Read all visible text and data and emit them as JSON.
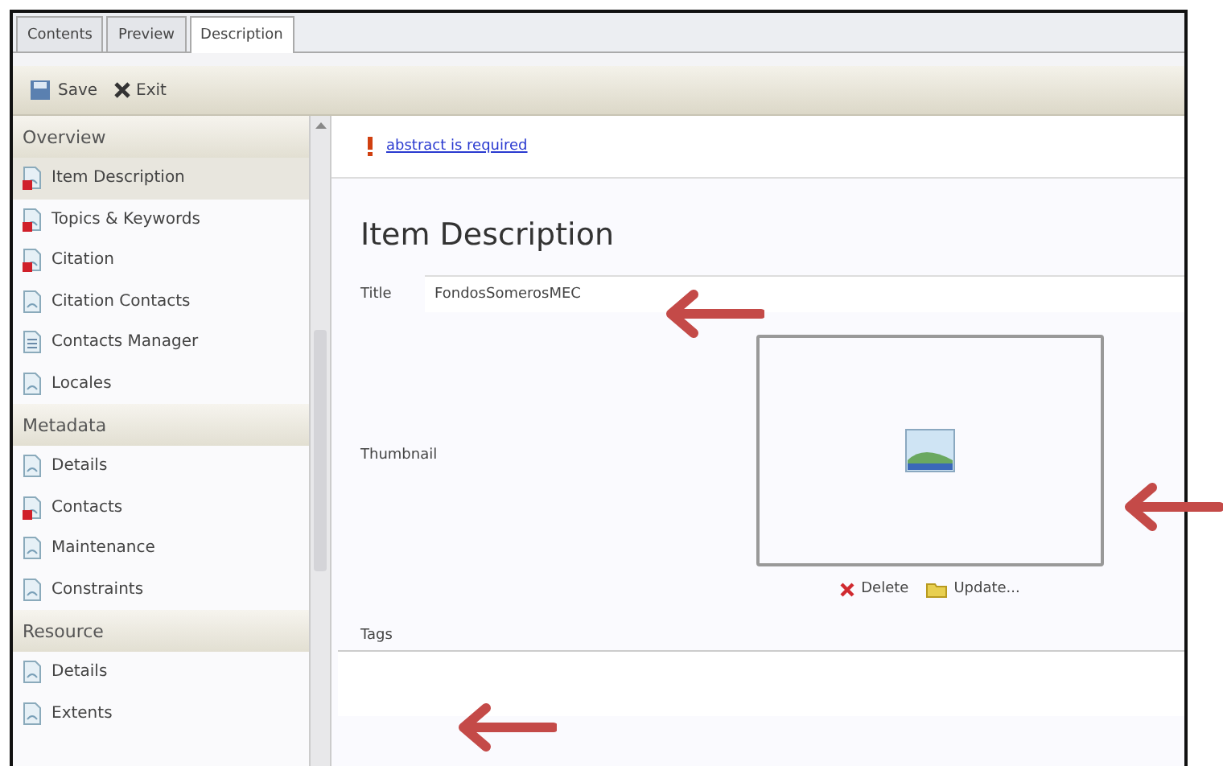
{
  "tabs": [
    {
      "label": "Contents",
      "selected": false
    },
    {
      "label": "Preview",
      "selected": false
    },
    {
      "label": "Description",
      "selected": true
    }
  ],
  "toolbar": [
    {
      "label": "Save",
      "kind": "save"
    },
    {
      "label": "Exit",
      "kind": "exit"
    }
  ],
  "sidebar": [
    {
      "title": "Overview",
      "items": [
        {
          "label": "Item Description",
          "error": true,
          "selected": true
        },
        {
          "label": "Topics & Keywords",
          "error": true,
          "selected": false
        },
        {
          "label": "Citation",
          "error": true,
          "selected": false
        },
        {
          "label": "Citation Contacts",
          "error": false,
          "selected": false
        },
        {
          "label": "Contacts Manager",
          "error": false,
          "selected": false,
          "kind": "list"
        },
        {
          "label": "Locales",
          "error": false,
          "selected": false
        }
      ]
    },
    {
      "title": "Metadata",
      "items": [
        {
          "label": "Details",
          "error": false,
          "selected": false
        },
        {
          "label": "Contacts",
          "error": true,
          "selected": false
        },
        {
          "label": "Maintenance",
          "error": false,
          "selected": false
        },
        {
          "label": "Constraints",
          "error": false,
          "selected": false
        }
      ]
    },
    {
      "title": "Resource",
      "items": [
        {
          "label": "Details",
          "error": false,
          "selected": false
        },
        {
          "label": "Extents",
          "error": false,
          "selected": false
        }
      ]
    }
  ],
  "message": {
    "link": "abstract is required"
  },
  "heading": "Item Description",
  "title_field": {
    "label": "Title",
    "value": "FondosSomerosMEC"
  },
  "thumbnail": {
    "label": "Thumbnail",
    "actions": [
      {
        "label": "Delete",
        "kind": "delete"
      },
      {
        "label": "Update...",
        "kind": "update"
      }
    ]
  },
  "tags": {
    "label": "Tags"
  }
}
